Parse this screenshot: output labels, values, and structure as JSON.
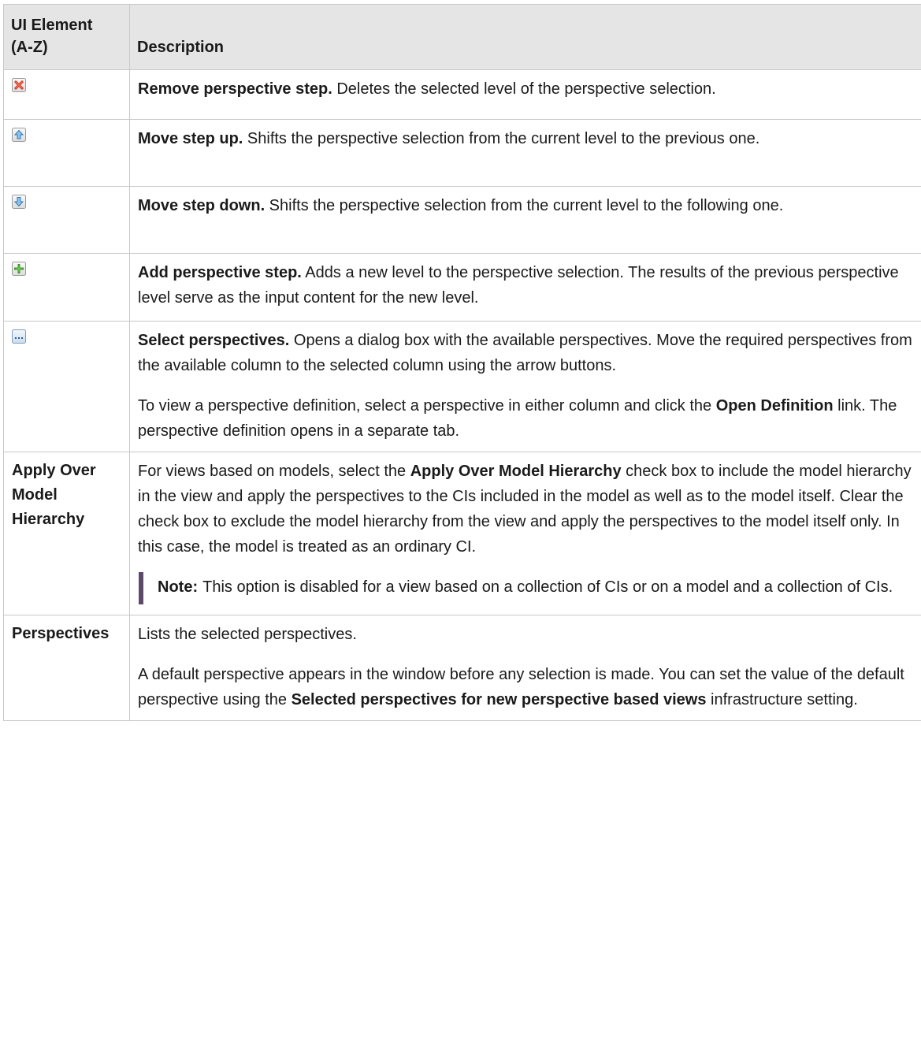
{
  "table": {
    "header": {
      "col1": "UI Element (A-Z)",
      "col1_line1": "UI Element",
      "col1_line2": "(A-Z)",
      "col2": "Description"
    },
    "rows": [
      {
        "icon": "remove-step-icon",
        "title": "Remove perspective step.",
        "text": " Deletes the selected level of the perspective selection."
      },
      {
        "icon": "move-up-icon",
        "title": "Move step up.",
        "text": " Shifts the perspective selection from the current level to the previous one."
      },
      {
        "icon": "move-down-icon",
        "title": "Move step down.",
        "text": " Shifts the perspective selection from the current level to the following one."
      },
      {
        "icon": "add-step-icon",
        "title": "Add perspective step.",
        "text": " Adds a new level to the perspective selection. The results of the previous perspective level serve as the input content for the new level."
      },
      {
        "icon": "select-perspectives-icon",
        "title": "Select perspectives.",
        "text": " Opens a dialog box with the available perspectives. Move the required perspectives from the available column to the selected column using the arrow buttons.",
        "p2_pre": "To view a perspective definition, select a perspective in either column and click the ",
        "p2_bold": "Open Definition",
        "p2_post": " link. The perspective definition opens in a separate tab."
      },
      {
        "element": "Apply Over Model Hierarchy",
        "element_lines": [
          "Apply Over",
          "Model",
          "Hierarchy"
        ],
        "p1_pre": "For views based on models, select the ",
        "p1_bold": "Apply Over Model Hierarchy",
        "p1_post": " check box to include the model hierarchy in the view and apply the perspectives to the CIs included in the model as well as to the model itself. Clear the check box to exclude the model hierarchy from the view and apply the perspectives to the model itself only. In this case, the model is treated as an ordinary CI.",
        "note_label": "Note:",
        "note_text": "This option is disabled for a view based on a collection of CIs or on a model and a collection of CIs."
      },
      {
        "element": "Perspectives",
        "p1": "Lists the selected perspectives.",
        "p2_pre": "A default perspective appears in the window before any selection is made. You can set the value of the default perspective using the ",
        "p2_bold": "Selected perspectives for new perspective based views",
        "p2_post": " infrastructure setting."
      }
    ]
  },
  "colors": {
    "header_bg": "#e5e5e5",
    "border": "#c8c8c8",
    "note_bar": "#5b4a6a"
  }
}
